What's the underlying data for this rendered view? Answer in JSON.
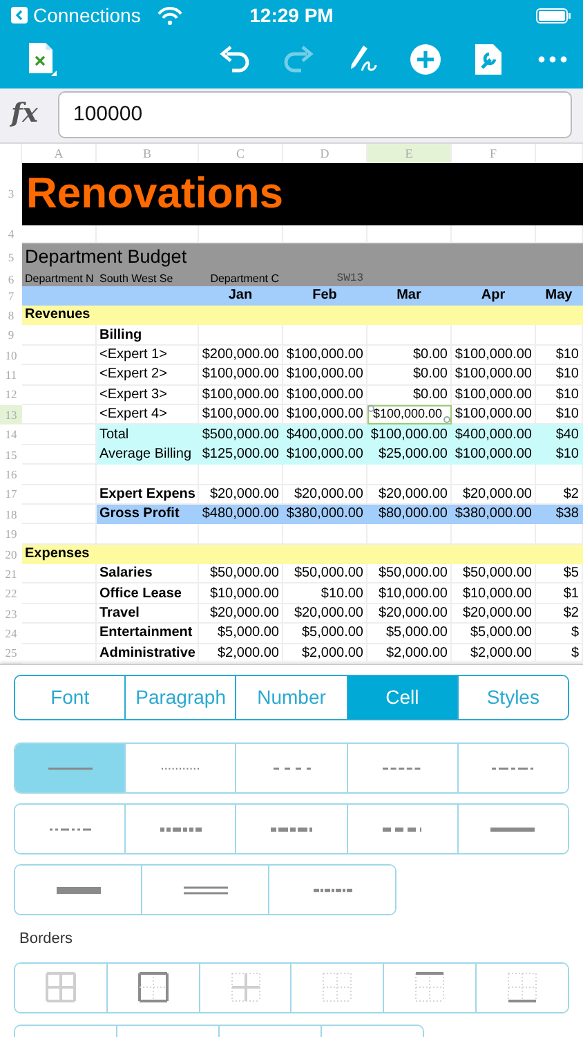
{
  "status_bar": {
    "back_label": "Connections",
    "time": "12:29 PM"
  },
  "toolbar": {
    "redo_disabled": true
  },
  "formula_bar": {
    "label": "fx",
    "value": "100000"
  },
  "columns": [
    {
      "label": "A",
      "selected": false
    },
    {
      "label": "B",
      "selected": false
    },
    {
      "label": "C",
      "selected": false
    },
    {
      "label": "D",
      "selected": false
    },
    {
      "label": "E",
      "selected": true
    },
    {
      "label": "F",
      "selected": false
    }
  ],
  "rows": [
    {
      "number": "3",
      "selected": false,
      "kind": "title",
      "cells": {
        "A": "Renovations"
      }
    },
    {
      "number": "4",
      "selected": false,
      "kind": "blank",
      "cells": {}
    },
    {
      "number": "5",
      "selected": false,
      "kind": "heading",
      "cells": {
        "A": "Department Budget"
      }
    },
    {
      "number": "6",
      "selected": false,
      "kind": "subheading",
      "cells": {
        "A": "Department N",
        "B": "South West Se",
        "C": "Department C",
        "D": "SW13"
      }
    },
    {
      "number": "7",
      "selected": false,
      "kind": "months",
      "cells": {
        "C": "Jan",
        "D": "Feb",
        "E": "Mar",
        "F": "Apr",
        "column_7": "May"
      }
    },
    {
      "number": "8",
      "selected": false,
      "kind": "section",
      "cells": {
        "A": "Revenues"
      }
    },
    {
      "number": "9",
      "selected": false,
      "kind": "data",
      "bold_label": true,
      "cells": {
        "B": "Billing"
      }
    },
    {
      "number": "10",
      "selected": false,
      "kind": "data",
      "cells": {
        "B": "<Expert 1>",
        "C": "$200,000.00",
        "D": "$100,000.00",
        "E": "$0.00",
        "F": "$100,000.00",
        "column_7": "$10"
      }
    },
    {
      "number": "11",
      "selected": false,
      "kind": "data",
      "cells": {
        "B": "<Expert 2>",
        "C": "$100,000.00",
        "D": "$100,000.00",
        "E": "$0.00",
        "F": "$100,000.00",
        "column_7": "$10"
      }
    },
    {
      "number": "12",
      "selected": false,
      "kind": "data",
      "cells": {
        "B": "<Expert 3>",
        "C": "$100,000.00",
        "D": "$100,000.00",
        "E": "$0.00",
        "F": "$100,000.00",
        "column_7": "$10"
      }
    },
    {
      "number": "13",
      "selected": true,
      "kind": "data",
      "cells": {
        "B": "<Expert 4>",
        "C": "$100,000.00",
        "D": "$100,000.00",
        "E": "$100,000.00",
        "F": "$100,000.00",
        "column_7": "$10"
      }
    },
    {
      "number": "14",
      "selected": false,
      "kind": "total",
      "cells": {
        "B": "Total",
        "C": "$500,000.00",
        "D": "$400,000.00",
        "E": "$100,000.00",
        "F": "$400,000.00",
        "column_7": "$40"
      }
    },
    {
      "number": "15",
      "selected": false,
      "kind": "total",
      "cells": {
        "B": "Average Billing",
        "C": "$125,000.00",
        "D": "$100,000.00",
        "E": "$25,000.00",
        "F": "$100,000.00",
        "column_7": "$10"
      }
    },
    {
      "number": "16",
      "selected": false,
      "kind": "data",
      "cells": {}
    },
    {
      "number": "17",
      "selected": false,
      "kind": "data",
      "bold_label": true,
      "cells": {
        "B": "Expert Expens",
        "C": "$20,000.00",
        "D": "$20,000.00",
        "E": "$20,000.00",
        "F": "$20,000.00",
        "column_7": "$2"
      }
    },
    {
      "number": "18",
      "selected": false,
      "kind": "profit",
      "bold_label": true,
      "cells": {
        "B": "Gross Profit",
        "C": "$480,000.00",
        "D": "$380,000.00",
        "E": "$80,000.00",
        "F": "$380,000.00",
        "column_7": "$38"
      }
    },
    {
      "number": "19",
      "selected": false,
      "kind": "data",
      "cells": {}
    },
    {
      "number": "20",
      "selected": false,
      "kind": "section",
      "cells": {
        "A": "Expenses"
      }
    },
    {
      "number": "21",
      "selected": false,
      "kind": "data",
      "bold_label": true,
      "cells": {
        "B": "Salaries",
        "C": "$50,000.00",
        "D": "$50,000.00",
        "E": "$50,000.00",
        "F": "$50,000.00",
        "column_7": "$5"
      }
    },
    {
      "number": "22",
      "selected": false,
      "kind": "data",
      "bold_label": true,
      "cells": {
        "B": "Office Lease",
        "C": "$10,000.00",
        "D": "$10.00",
        "E": "$10,000.00",
        "F": "$10,000.00",
        "column_7": "$1"
      }
    },
    {
      "number": "23",
      "selected": false,
      "kind": "data",
      "bold_label": true,
      "cells": {
        "B": "Travel",
        "C": "$20,000.00",
        "D": "$20,000.00",
        "E": "$20,000.00",
        "F": "$20,000.00",
        "column_7": "$2"
      }
    },
    {
      "number": "24",
      "selected": false,
      "kind": "data",
      "bold_label": true,
      "cells": {
        "B": "Entertainment",
        "C": "$5,000.00",
        "D": "$5,000.00",
        "E": "$5,000.00",
        "F": "$5,000.00",
        "column_7": "$"
      }
    },
    {
      "number": "25",
      "selected": false,
      "kind": "data",
      "bold_label": true,
      "cells": {
        "B": "Administrative",
        "C": "$2,000.00",
        "D": "$2,000.00",
        "E": "$2,000.00",
        "F": "$2,000.00",
        "column_7": "$"
      }
    }
  ],
  "format_tabs": [
    {
      "label": "Font",
      "selected": false
    },
    {
      "label": "Paragraph",
      "selected": false
    },
    {
      "label": "Number",
      "selected": false
    },
    {
      "label": "Cell",
      "selected": true
    },
    {
      "label": "Styles",
      "selected": false
    }
  ],
  "line_style_rows": [
    [
      {
        "kind": "thin",
        "selected": true
      },
      {
        "kind": "hair-dot",
        "selected": false
      },
      {
        "kind": "dash",
        "selected": false
      },
      {
        "kind": "dash-small",
        "selected": false
      },
      {
        "kind": "dash-dot",
        "selected": false
      }
    ],
    [
      {
        "kind": "dash-dot-dot",
        "selected": false
      },
      {
        "kind": "medium-dash-dot-dot",
        "selected": false
      },
      {
        "kind": "medium-dash-dot",
        "selected": false
      },
      {
        "kind": "medium-dash",
        "selected": false
      },
      {
        "kind": "medium",
        "selected": false
      }
    ],
    [
      {
        "kind": "thick",
        "selected": false
      },
      {
        "kind": "double",
        "selected": false
      },
      {
        "kind": "slant-dash-dot",
        "selected": false
      }
    ]
  ],
  "borders_label": "Borders",
  "border_rows": [
    [
      {
        "kind": "all"
      },
      {
        "kind": "outside"
      },
      {
        "kind": "inside"
      },
      {
        "kind": "none"
      },
      {
        "kind": "top"
      },
      {
        "kind": "bottom"
      }
    ],
    [
      {
        "kind": "cut-off"
      },
      {
        "kind": "cut-off"
      },
      {
        "kind": "cut-off"
      },
      {
        "kind": "cut-off"
      }
    ]
  ]
}
